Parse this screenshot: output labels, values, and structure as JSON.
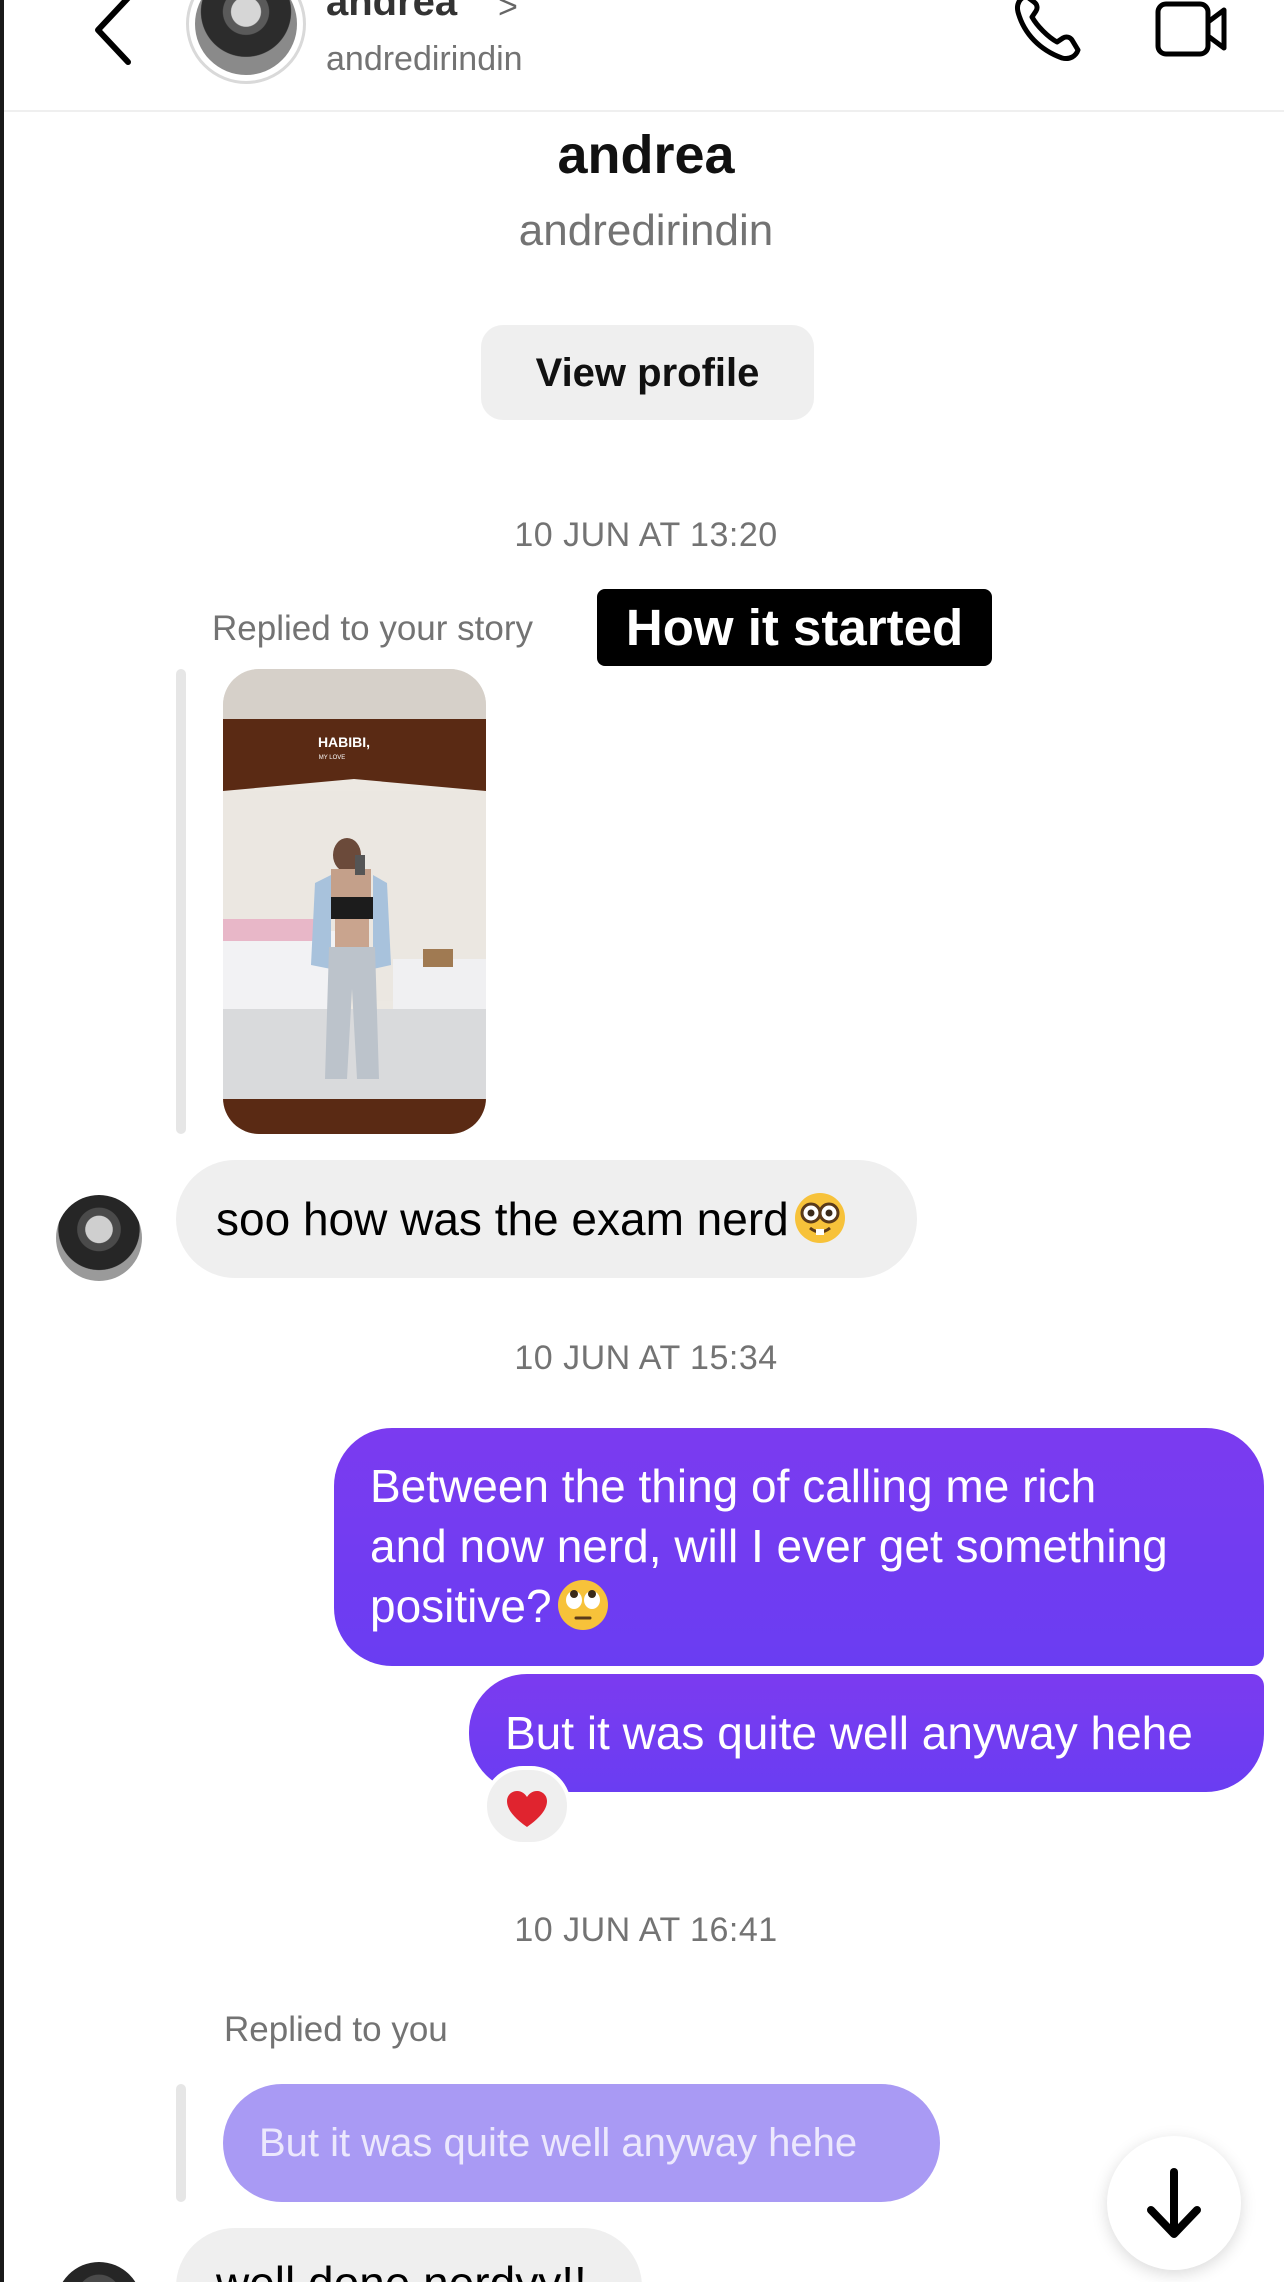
{
  "header": {
    "contact_name": "andrea",
    "contact_chevron": ">",
    "contact_handle": "andredirindin",
    "back_icon": "chevron-left-icon",
    "call_icon": "phone-icon",
    "video_icon": "video-camera-icon"
  },
  "profile": {
    "name": "andrea",
    "handle": "andredirindin",
    "view_profile_label": "View profile"
  },
  "thread": {
    "timestamp_1": "10 JUN AT 13:20",
    "story_reply_label": "Replied to your story",
    "story_caption": "How it started",
    "story_sticker_text": "HABIBI,",
    "story_sticker_subtext": "MY LOVE",
    "msg_1": "soo how was the exam nerd",
    "msg_1_emoji": "nerd-face-icon",
    "timestamp_2": "10 JUN AT 15:34",
    "msg_2_lines": [
      "Between the thing of calling me rich",
      "and now nerd, will I ever get something",
      "positive?"
    ],
    "msg_2_emoji": "eye-roll-face-icon",
    "msg_3": "But it was quite well anyway hehe",
    "msg_3_reaction": "red-heart-icon",
    "timestamp_3": "10 JUN AT 16:41",
    "reply_label": "Replied to you",
    "quoted_text": "But it was quite well anyway hehe",
    "msg_4_partial": "well done nerdyy!!"
  },
  "colors": {
    "outgoing_bubble": "#6a3df2",
    "incoming_bubble": "#efefef",
    "quoted_bubble": "#a99af4",
    "muted_text": "#737373"
  }
}
